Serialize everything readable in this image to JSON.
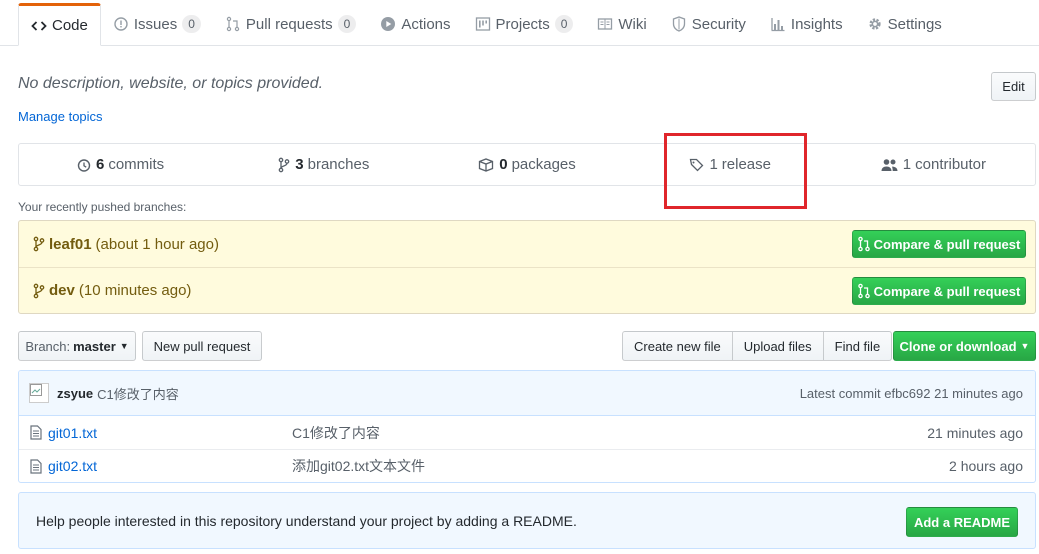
{
  "tabs": [
    {
      "label": "Code",
      "icon": "code-icon",
      "active": true
    },
    {
      "label": "Issues",
      "icon": "issue-icon",
      "count": "0"
    },
    {
      "label": "Pull requests",
      "icon": "pull-request-icon",
      "count": "0"
    },
    {
      "label": "Actions",
      "icon": "play-icon"
    },
    {
      "label": "Projects",
      "icon": "project-icon",
      "count": "0"
    },
    {
      "label": "Wiki",
      "icon": "book-icon"
    },
    {
      "label": "Security",
      "icon": "shield-icon"
    },
    {
      "label": "Insights",
      "icon": "graph-icon"
    },
    {
      "label": "Settings",
      "icon": "gear-icon"
    }
  ],
  "repo": {
    "description": "No description, website, or topics provided.",
    "manage_topics": "Manage topics",
    "edit_label": "Edit"
  },
  "summary": {
    "commits": {
      "count": "6",
      "label": "commits"
    },
    "branches": {
      "count": "3",
      "label": "branches"
    },
    "packages": {
      "count": "0",
      "label": "packages"
    },
    "releases": {
      "count": "1",
      "label": "release"
    },
    "contributors": {
      "count": "1",
      "label": "contributor"
    }
  },
  "recent": {
    "label": "Your recently pushed branches:",
    "compare_label": "Compare & pull request",
    "branches": [
      {
        "name": "leaf01",
        "time": "(about 1 hour ago)"
      },
      {
        "name": "dev",
        "time": "(10 minutes ago)"
      }
    ]
  },
  "toolbar": {
    "branch_label": "Branch:",
    "branch_value": "master",
    "new_pr": "New pull request",
    "create_file": "Create new file",
    "upload_files": "Upload files",
    "find_file": "Find file",
    "clone": "Clone or download"
  },
  "commit": {
    "author": "zsyue",
    "message": "C1修改了内容",
    "latest": "Latest commit efbc692 21 minutes ago"
  },
  "files": [
    {
      "name": "git01.txt",
      "message": "C1修改了内容",
      "age": "21 minutes ago"
    },
    {
      "name": "git02.txt",
      "message": "添加git02.txt文本文件",
      "age": "2 hours ago"
    }
  ],
  "readme": {
    "text": "Help people interested in this repository understand your project by adding a README.",
    "button": "Add a README"
  },
  "colors": {
    "accent": "#e36209",
    "link": "#0366d6",
    "green": "#28a745",
    "highlight_box": "#e0262b"
  }
}
